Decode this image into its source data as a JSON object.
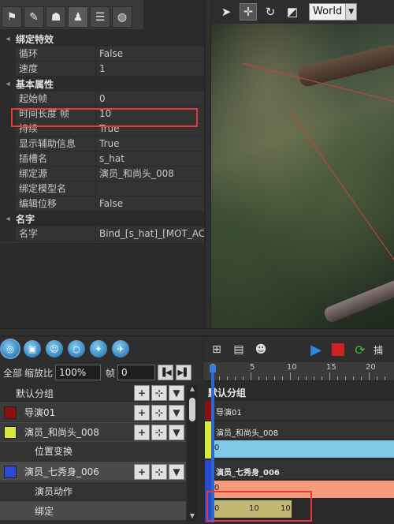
{
  "tabs": [
    {
      "icon": "flag-icon",
      "glyph": "⚑"
    },
    {
      "icon": "pen-icon",
      "glyph": "✎"
    },
    {
      "icon": "director-icon",
      "glyph": "☗"
    },
    {
      "icon": "actor-icon",
      "glyph": "♟"
    },
    {
      "icon": "list-icon",
      "glyph": "☰"
    },
    {
      "icon": "globe-icon",
      "glyph": "◍"
    }
  ],
  "properties": {
    "binding_section": "绑定特效",
    "loop_label": "循环",
    "loop_value": "False",
    "speed_label": "速度",
    "speed_value": "1",
    "basic_section": "基本属性",
    "start_label": "起始帧",
    "start_value": "0",
    "duration_label": "时间长度 帧",
    "duration_value": "10",
    "persist_label": "持续",
    "persist_value": "True",
    "helper_label": "显示辅助信息",
    "helper_value": "True",
    "slot_label": "插槽名",
    "slot_value": "s_hat",
    "source_label": "绑定源",
    "source_value": "演员_和尚头_008",
    "model_label": "绑定模型名",
    "model_value": "",
    "offset_label": "编辑位移",
    "offset_value": "False",
    "name_section": "名字",
    "name_label": "名字",
    "name_value": "Bind_[s_hat]_[MOT_ACT"
  },
  "viewport": {
    "space_select": "World"
  },
  "groups_panel": {
    "all_label": "全部",
    "zoom_label": "缩放比",
    "zoom_value": "100%",
    "frame_label": "帧",
    "frame_value": "0",
    "default_group": "默认分组",
    "tracks": [
      {
        "label": "导演01",
        "color": "#8a0f0f"
      },
      {
        "label": "演员_和尚头_008",
        "color": "#d8e840"
      },
      {
        "label": "位置变换",
        "color": ""
      },
      {
        "label": "演员_七秀身_006",
        "color": "#2a4ad0"
      },
      {
        "label": "演员动作",
        "color": ""
      },
      {
        "label": "绑定",
        "color": ""
      }
    ]
  },
  "timeline": {
    "ruler_labels": [
      "0",
      "5",
      "10",
      "15",
      "20"
    ],
    "group_label": "默认分组",
    "director_label": "导演01",
    "actor1_label": "演员_和尚头_008",
    "actor1_clip_start": "0",
    "actor2_label": "演员_七秀身_006",
    "actor2_clip_start": "0",
    "bind_clip_labels": [
      "0",
      "10",
      "10"
    ],
    "more_label": "捕"
  },
  "colors": {
    "highlight": "#e23a3a",
    "clip_blue": "#7ec9e6",
    "clip_salmon": "#f49b7a",
    "clip_olive": "#c2b874",
    "play": "#2a8ae0",
    "stop": "#d02020"
  }
}
